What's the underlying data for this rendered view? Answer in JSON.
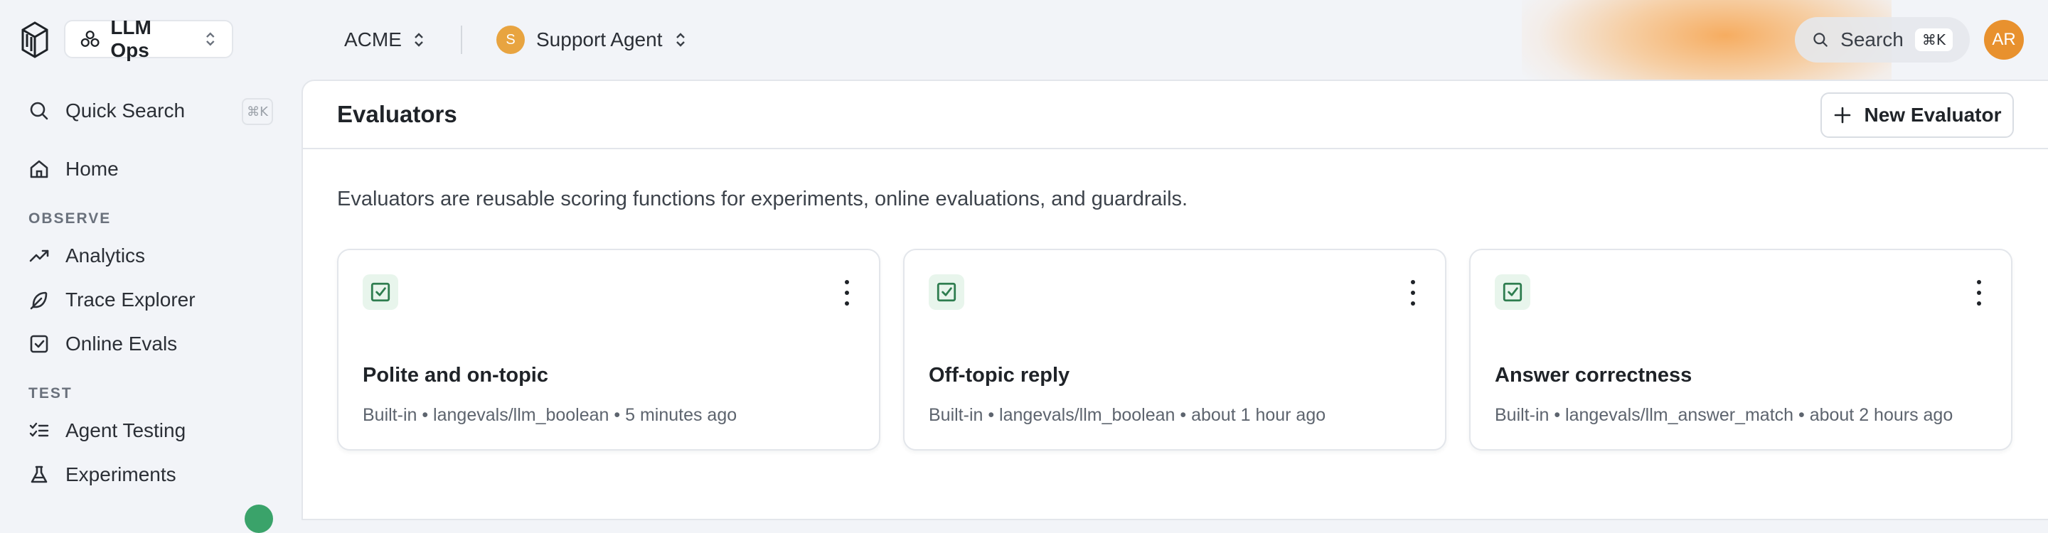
{
  "topbar": {
    "project": "LLM Ops",
    "org": "ACME",
    "agent_initial": "S",
    "agent": "Support Agent",
    "search_label": "Search",
    "search_shortcut": "⌘K",
    "user_initials": "AR"
  },
  "sidebar": {
    "quick_search": "Quick Search",
    "quick_search_shortcut": "⌘K",
    "home": "Home",
    "section_observe": "OBSERVE",
    "analytics": "Analytics",
    "trace_explorer": "Trace Explorer",
    "online_evals": "Online Evals",
    "section_test": "TEST",
    "agent_testing": "Agent Testing",
    "experiments": "Experiments"
  },
  "main": {
    "title": "Evaluators",
    "new_button": "New Evaluator",
    "description": "Evaluators are reusable scoring functions for experiments, online evaluations, and guardrails.",
    "cards": [
      {
        "title": "Polite and on-topic",
        "meta": "Built-in • langevals/llm_boolean • 5 minutes ago"
      },
      {
        "title": "Off-topic reply",
        "meta": "Built-in • langevals/llm_boolean • about 1 hour ago"
      },
      {
        "title": "Answer correctness",
        "meta": "Built-in • langevals/llm_answer_match • about 2 hours ago"
      }
    ]
  },
  "colors": {
    "accent_green": "#2e9c5f",
    "avatar_orange": "#e8912e",
    "agent_avatar": "#e8a440"
  }
}
